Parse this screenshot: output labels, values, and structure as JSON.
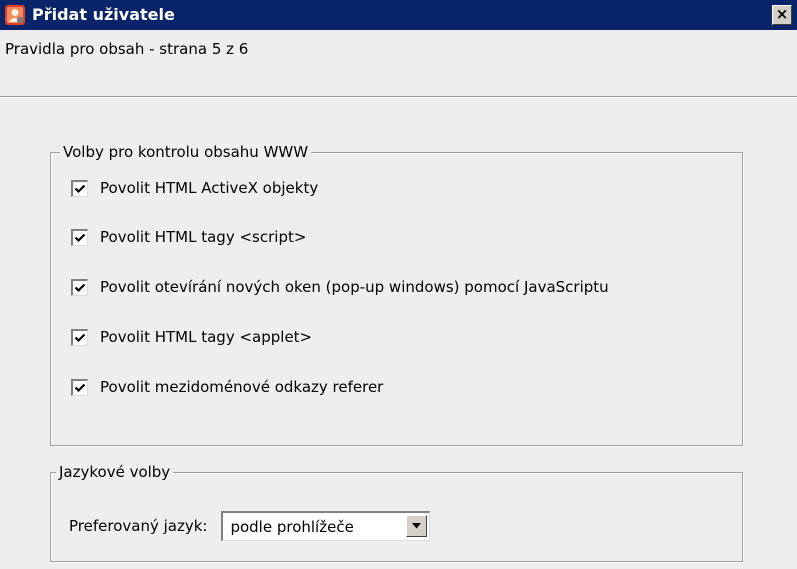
{
  "window": {
    "title": "Přidat uživatele",
    "close_label": "×",
    "subtitle": "Pravidla pro obsah - strana 5 z 6"
  },
  "www_group": {
    "legend": "Volby pro kontrolu obsahu WWW",
    "options": [
      {
        "label": "Povolit HTML ActiveX objekty",
        "checked": true
      },
      {
        "label": "Povolit HTML tagy <script>",
        "checked": true
      },
      {
        "label": "Povolit otevírání nových oken (pop-up windows) pomocí JavaScriptu",
        "checked": true
      },
      {
        "label": "Povolit HTML tagy <applet>",
        "checked": true
      },
      {
        "label": "Povolit mezidoménové odkazy referer",
        "checked": true
      }
    ]
  },
  "language_group": {
    "legend": "Jazykové volby",
    "label": "Preferovaný jazyk:",
    "selected": "podle prohlížeče"
  },
  "colors": {
    "titlebar": "#0a246a",
    "face": "#eeeeee"
  },
  "icons": {
    "app": "user-add-icon",
    "close": "close-icon",
    "check": "check-icon",
    "dropdown": "chevron-down-icon"
  }
}
